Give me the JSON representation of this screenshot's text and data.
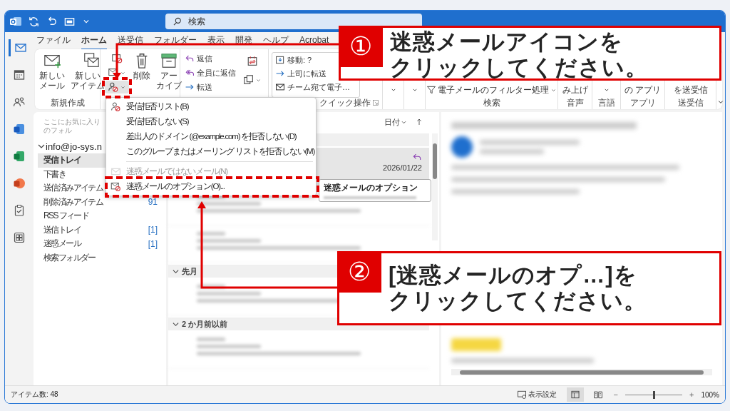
{
  "title_bar": {
    "search": {
      "placeholder": "検索"
    }
  },
  "nav_rail": [
    {
      "kind": "mail",
      "selected": true
    },
    {
      "kind": "calendar",
      "selected": false
    },
    {
      "kind": "people",
      "selected": false
    },
    {
      "kind": "word",
      "selected": false
    },
    {
      "kind": "excel",
      "selected": false
    },
    {
      "kind": "powerpoint",
      "selected": false
    },
    {
      "kind": "tasks",
      "selected": false
    },
    {
      "kind": "apps",
      "selected": false
    }
  ],
  "tabs": [
    {
      "label": "ファイル",
      "selected": false
    },
    {
      "label": "ホーム",
      "selected": true
    },
    {
      "label": "送受信",
      "selected": false
    },
    {
      "label": "フォルダー",
      "selected": false
    },
    {
      "label": "表示",
      "selected": false
    },
    {
      "label": "開発",
      "selected": false
    },
    {
      "label": "ヘルプ",
      "selected": false
    },
    {
      "label": "Acrobat",
      "selected": false
    }
  ],
  "ribbon": {
    "new_group": {
      "label": "新規作成",
      "buttons": [
        {
          "lines": [
            "新しい",
            "メール"
          ],
          "kind": "new-mail"
        },
        {
          "lines": [
            "新しい",
            "アイテム"
          ],
          "kind": "new-item"
        }
      ]
    },
    "delete_group": {
      "junk_button": {
        "expanded": true
      },
      "buttons": [
        {
          "lines": [
            "削除"
          ],
          "kind": "delete"
        },
        {
          "lines": [
            "アー",
            "カイブ"
          ],
          "kind": "archive"
        }
      ]
    },
    "respond_group": {
      "buttons": [
        {
          "label": "返信",
          "kind": "reply"
        },
        {
          "label": "全員に返信",
          "kind": "reply-all"
        },
        {
          "label": "転送",
          "kind": "forward"
        }
      ]
    },
    "quick_steps": {
      "label": "クイック操作",
      "items": [
        {
          "label": "移動: ?",
          "kind": "move"
        },
        {
          "label": "上司に転送",
          "kind": "forward"
        },
        {
          "label": "チーム宛て電子…",
          "kind": "mail"
        }
      ]
    },
    "right_groups": [
      {
        "kind": "caret"
      },
      {
        "kind": "caret"
      },
      {
        "kind": "filter",
        "button": "電子メールのフィルター処理",
        "label": "検索"
      },
      {
        "kind": "text",
        "button": "み上げ",
        "label": "音声"
      },
      {
        "kind": "caret",
        "label": "言語"
      },
      {
        "kind": "text",
        "button": "の アプリ",
        "label": "アプリ"
      },
      {
        "kind": "text",
        "button": "を送受信",
        "label": "送受信"
      }
    ]
  },
  "folder_pane": {
    "favorites_hint": "ここにお気に入りのフォル",
    "account": {
      "name": "info@jo-sys.n",
      "expanded": true
    },
    "folders": [
      {
        "name": "受信トレイ",
        "selected": true
      },
      {
        "name": "下書き",
        "selected": false
      },
      {
        "name": "送信済みアイテム",
        "selected": false
      },
      {
        "name": "削除済みアイテム",
        "count": "91",
        "selected": false
      },
      {
        "name": "RSS フィード",
        "selected": false
      },
      {
        "name": "送信トレイ",
        "count": "[1]",
        "selected": false
      },
      {
        "name": "迷惑メール",
        "count": "[1]",
        "selected": false
      },
      {
        "name": "検索フォルダー",
        "selected": false
      }
    ]
  },
  "message_list": {
    "sort": {
      "label": "日付"
    },
    "items": [
      {
        "kind": "group"
      },
      {
        "kind": "message",
        "selected": true,
        "replied": true,
        "date": "2026/01/22"
      },
      {
        "kind": "blurred"
      },
      {
        "kind": "blurred"
      },
      {
        "kind": "group",
        "label": "先月",
        "expanded": true
      },
      {
        "kind": "blurred"
      },
      {
        "kind": "group",
        "label": "2 か月前以前",
        "expanded": true
      },
      {
        "kind": "blurred"
      }
    ]
  },
  "tooltip": {
    "title": "迷惑メールのオプション"
  },
  "junk_menu": {
    "items": [
      {
        "kind": "blocked-senders",
        "label": "受信拒否リスト(B)",
        "disabled": false
      },
      {
        "kind": "plain",
        "label": "受信拒否しない(S)",
        "disabled": false
      },
      {
        "kind": "plain",
        "label": "差出人のドメイン (@example.com) を拒否しない(D)",
        "disabled": false
      },
      {
        "kind": "plain",
        "label": "このグループまたはメーリング リストを拒否しない(M)",
        "disabled": false
      },
      {
        "kind": "separator"
      },
      {
        "kind": "not-junk",
        "label": "迷惑メールではないメール(N)",
        "disabled": true
      },
      {
        "kind": "junk-options",
        "label": "迷惑メールのオプション(O)...",
        "disabled": false
      }
    ]
  },
  "callouts": [
    {
      "number": "①",
      "lines": [
        "迷惑メールアイコンを",
        "クリックしてください。"
      ]
    },
    {
      "number": "②",
      "lines": [
        "[迷惑メールのオプ…]を",
        "クリックしてください。"
      ]
    }
  ],
  "status_bar": {
    "item_count": "アイテム数: 48",
    "view_settings": "表示設定",
    "zoom_out": "−",
    "zoom_in": "+",
    "zoom": {
      "level": 0.5,
      "reading": "100%"
    }
  }
}
